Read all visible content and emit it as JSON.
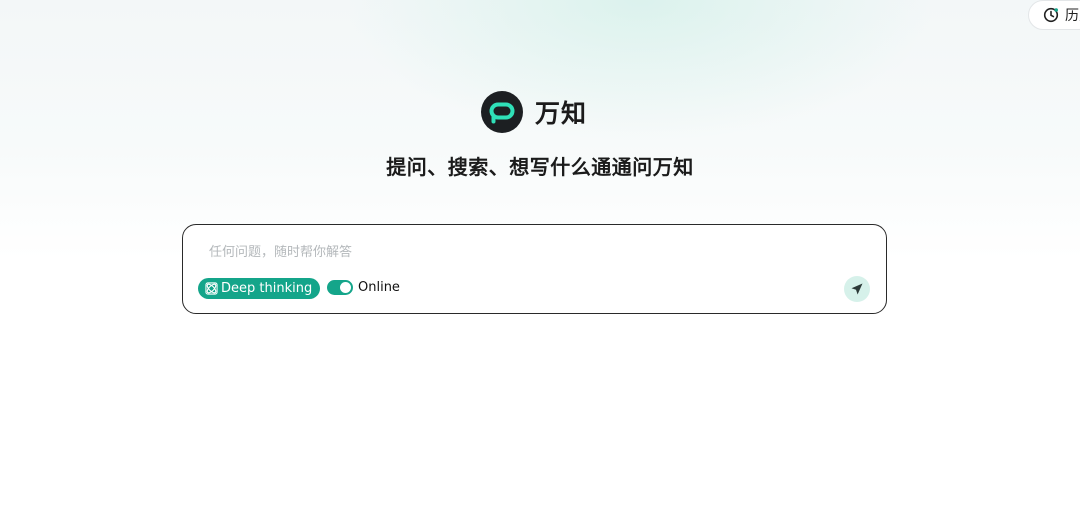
{
  "header": {
    "history_label": "历史",
    "history_icon": "clock-icon"
  },
  "brand": {
    "name": "万知",
    "logo_icon": "wanzhi-logo-icon",
    "accent_color": "#14a58a"
  },
  "tagline": "提问、搜索、想写什么通通问万知",
  "input": {
    "placeholder": "任何问题，随时帮你解答",
    "value": ""
  },
  "options": {
    "deep_thinking_label": "Deep thinking",
    "deep_thinking_icon": "atom-icon",
    "online_label": "Online",
    "online_enabled": true
  },
  "send": {
    "icon": "send-icon"
  }
}
